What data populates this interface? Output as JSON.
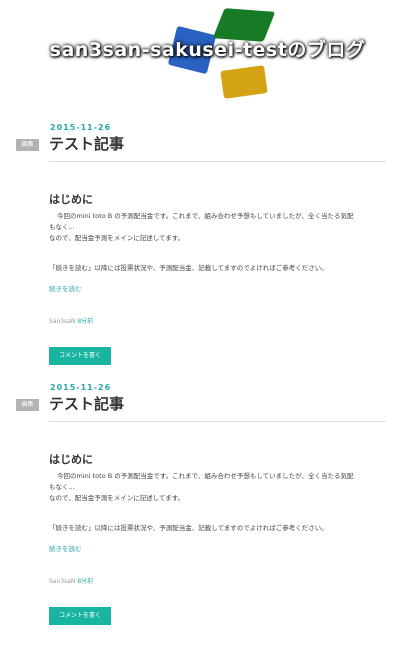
{
  "blog": {
    "title": "san3san-sakusei-testのブログ"
  },
  "colors": {
    "accent": "#2aa8a8",
    "button": "#1ab5a0",
    "logo_blue": "#2a62c2",
    "logo_green": "#177a24",
    "logo_yellow": "#d3a314"
  },
  "entries": [
    {
      "date": "2015-11-26",
      "edit_label": "編集",
      "title": "テスト記事",
      "heading": "はじめに",
      "para1_line1": "今回のmini toto B の予測配当金です。これまで、組み合わせ予想もしていましたが、全く当たる気配",
      "para1_line2": "もなく...",
      "para1_line3": "なので、配当金予測をメインに記述してます。",
      "para2": "「続きを読む」以降には投票状況や、予測配当金、記載してますのでよければご参考ください。",
      "read_more": "続きを読む",
      "author": "San3saN",
      "time_ago": "8分前",
      "comment_button": "コメントを書く"
    },
    {
      "date": "2015-11-26",
      "edit_label": "編集",
      "title": "テスト記事",
      "heading": "はじめに",
      "para1_line1": "今回のmini toto B の予測配当金です。これまで、組み合わせ予想もしていましたが、全く当たる気配",
      "para1_line2": "もなく...",
      "para1_line3": "なので、配当金予測をメインに記述してます。",
      "para2": "「続きを読む」以降には投票状況や、予測配当金、記載してますのでよければご参考ください。",
      "read_more": "続きを読む",
      "author": "San3saN",
      "time_ago": "8分前",
      "comment_button": "コメントを書く"
    }
  ]
}
